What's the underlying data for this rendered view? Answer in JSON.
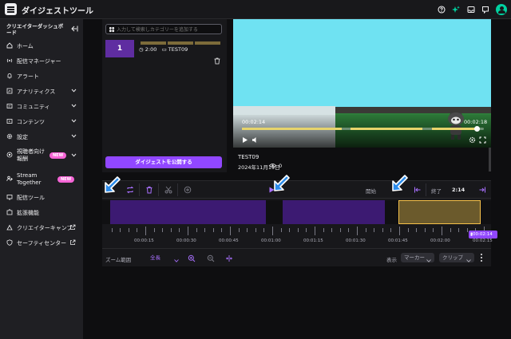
{
  "topbar": {
    "title": "ダイジェストツール"
  },
  "sidebar": {
    "header": "クリエイターダッシュボード",
    "items": [
      {
        "label": "ホーム",
        "icon": "home-icon"
      },
      {
        "label": "配信マネージャー",
        "icon": "broadcast-icon"
      },
      {
        "label": "アラート",
        "icon": "bell-icon"
      },
      {
        "label": "アナリティクス",
        "icon": "chart-icon"
      },
      {
        "label": "コミュニティ",
        "icon": "community-icon"
      },
      {
        "label": "コンテンツ",
        "icon": "content-icon"
      },
      {
        "label": "設定",
        "icon": "gear-icon"
      },
      {
        "label_line1": "視聴者向け",
        "label_line2": "報酬",
        "icon": "reward-icon",
        "badge": "NEW"
      },
      {
        "label_line1": "Stream",
        "label_line2": "Together",
        "icon": "stream-together-icon",
        "badge": "NEW"
      },
      {
        "label": "配信ツール",
        "icon": "tools-icon"
      },
      {
        "label": "拡張機能",
        "icon": "extension-icon"
      },
      {
        "label": "クリエイターキャンプ",
        "icon": "camp-icon"
      },
      {
        "label": "セーフティセンター",
        "icon": "shield-icon"
      }
    ]
  },
  "left_panel": {
    "search_placeholder": "入力して検索しカテゴリーを追加する",
    "clip": {
      "number": "1",
      "duration": "2:00",
      "tag": "TEST09"
    },
    "publish_label": "ダイジェストを公開する"
  },
  "player": {
    "time_current": "00:02:14",
    "time_end": "00:02:18",
    "progress": 0.97
  },
  "video_info": {
    "title": "TEST09",
    "date": "2024年11月19日",
    "views": "0"
  },
  "timeline": {
    "start_label": "開始",
    "end_label": "終了",
    "end_value": "2:14",
    "playhead_time": "00:02:14",
    "ruler_labels": [
      "00:00:15",
      "00:00:30",
      "00:00:45",
      "00:01:00",
      "00:01:15",
      "00:01:30",
      "00:01:45",
      "00:02:00",
      "00:02:15"
    ],
    "zoom_label": "ズーム範囲",
    "zoom_value": "全長",
    "show_label": "表示",
    "marker_label": "マーカー",
    "clip_label": "クリップ"
  },
  "colors": {
    "accent": "#9147ff",
    "segment": "#3c1a72",
    "selected_segment": "#f5c04a",
    "tutorial_arrow": "#2d8ceb"
  }
}
